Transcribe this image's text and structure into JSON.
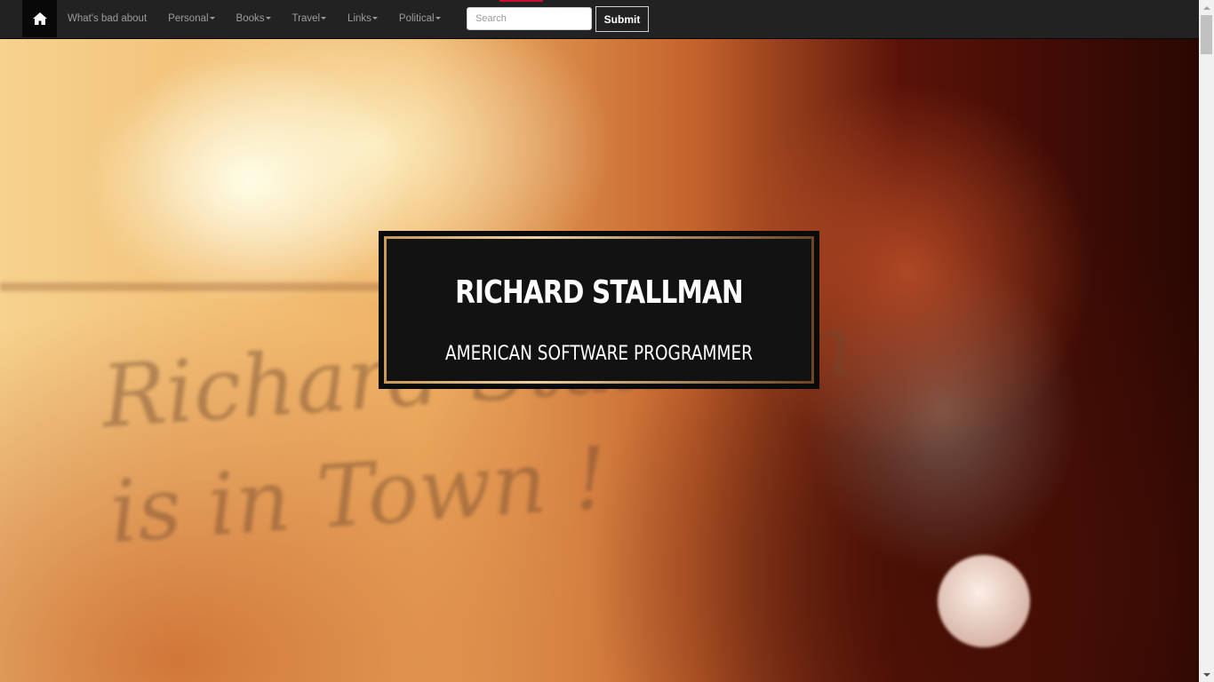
{
  "navbar": {
    "home_icon": "home-icon",
    "links": [
      {
        "label": "What's bad about",
        "has_caret": false
      },
      {
        "label": "Personal",
        "has_caret": true
      },
      {
        "label": "Books",
        "has_caret": true
      },
      {
        "label": "Travel",
        "has_caret": true
      },
      {
        "label": "Links",
        "has_caret": true
      },
      {
        "label": "Political",
        "has_caret": true
      }
    ],
    "search": {
      "placeholder": "Search",
      "value": ""
    },
    "submit_label": "Submit"
  },
  "hero": {
    "name": "RICHARD STALLMAN",
    "subtitle": "AMERICAN SOFTWARE PROGRAMMER",
    "photo_scribble": "Richard Stallman\nis in Town !"
  },
  "colors": {
    "navbar_bg": "#222222",
    "nav_text": "#9d9d9d",
    "accent_red": "#c80d2f",
    "frame_gold": "#ecd1a2"
  }
}
